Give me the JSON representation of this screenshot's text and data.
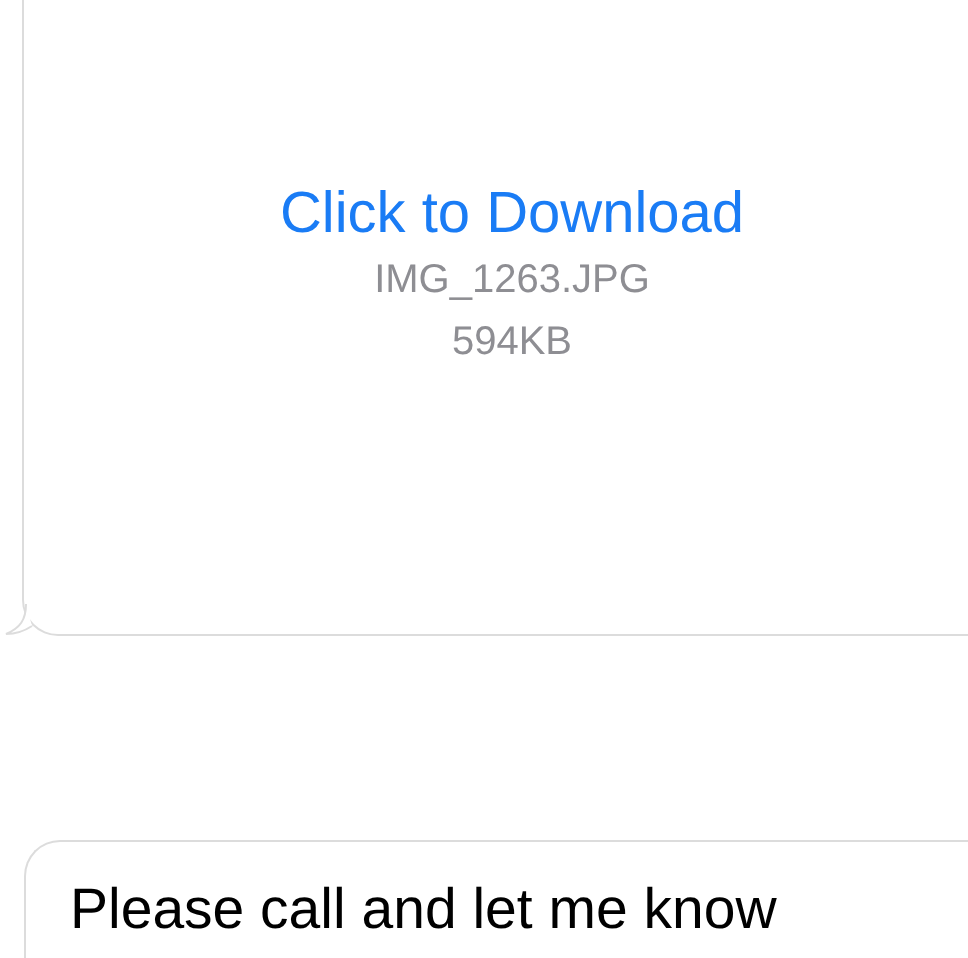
{
  "messages": [
    {
      "kind": "attachment",
      "link": "Click to Download",
      "filename": "IMG_1263.JPG",
      "size": "594KB"
    },
    {
      "kind": "text",
      "text": "Please call and let me know"
    }
  ]
}
